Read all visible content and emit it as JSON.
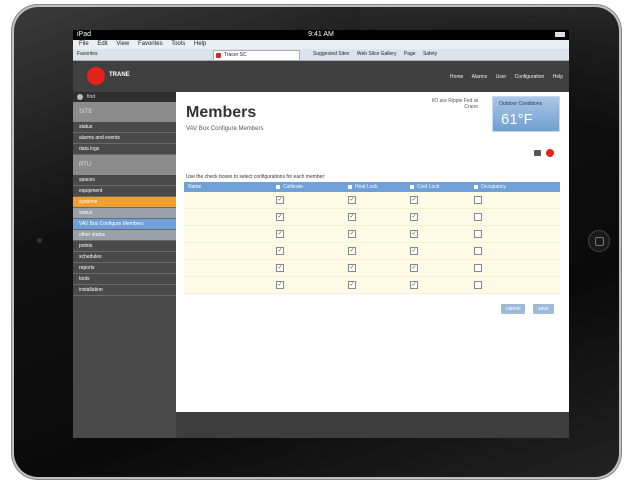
{
  "device": {
    "home_button": "home-button"
  },
  "status_bar": {
    "carrier": "iPad",
    "time": "9:41 AM"
  },
  "browser": {
    "menu": [
      "File",
      "Edit",
      "View",
      "Favorites",
      "Tools",
      "Help"
    ],
    "favorites": "Favorites",
    "tab_title": "Tracer SC",
    "commands": [
      "Suggested Sites",
      "Web Slice Gallery",
      "Page",
      "Safety"
    ]
  },
  "app": {
    "brand": "TRANE",
    "top_links": [
      "Home",
      "Alarms",
      "User",
      "Configuration",
      "Help"
    ]
  },
  "sidebar": {
    "search": "find",
    "sections": [
      {
        "kind": "head",
        "label": "SITE"
      },
      {
        "kind": "item",
        "label": "status"
      },
      {
        "kind": "item",
        "label": "alarms and events"
      },
      {
        "kind": "item",
        "label": "data logs"
      },
      {
        "kind": "head",
        "label": "RTU"
      },
      {
        "kind": "item",
        "label": "spaces"
      },
      {
        "kind": "item",
        "label": "equipment"
      },
      {
        "kind": "active",
        "label": "systems"
      },
      {
        "kind": "sub",
        "label": "status"
      },
      {
        "kind": "sel",
        "label": "VAV Box Configure Members"
      },
      {
        "kind": "sub",
        "label": "other status"
      },
      {
        "kind": "item",
        "label": "points"
      },
      {
        "kind": "item",
        "label": "schedules"
      },
      {
        "kind": "item",
        "label": "reports"
      },
      {
        "kind": "item",
        "label": "tools"
      },
      {
        "kind": "item",
        "label": "installation"
      }
    ]
  },
  "main": {
    "title": "Members",
    "subtitle": "VAV Box Configure Members",
    "note": "I/O are Ripple Fed at Crane",
    "weather": {
      "label": "Outdoor Conditions",
      "temp": "61°F"
    },
    "instructions": "Use the check boxes to select configurations for each member:",
    "columns": [
      "Name",
      "Calibrate",
      "Heat Lock",
      "Cool Lock",
      "Occupancy"
    ],
    "rows": [
      [
        true,
        true,
        true,
        false
      ],
      [
        true,
        true,
        true,
        false
      ],
      [
        true,
        true,
        true,
        false
      ],
      [
        true,
        true,
        true,
        false
      ],
      [
        true,
        true,
        true,
        false
      ],
      [
        true,
        true,
        true,
        false
      ]
    ],
    "cancel_label": "cancel",
    "save_label": "save"
  }
}
